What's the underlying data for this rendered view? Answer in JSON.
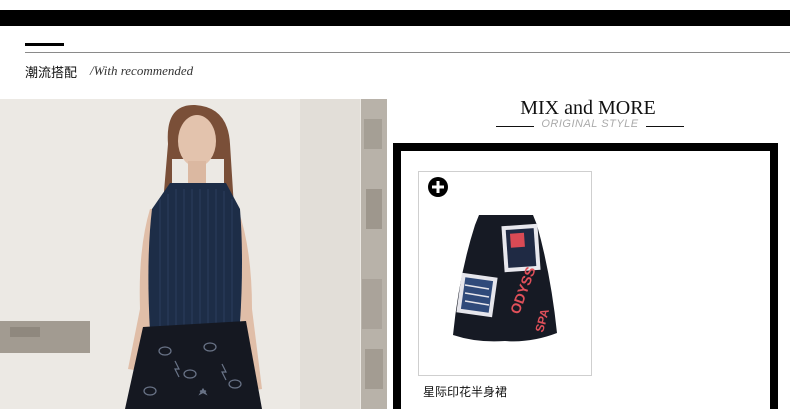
{
  "section": {
    "title_cn": "潮流搭配",
    "title_en": "/With recommended"
  },
  "mix": {
    "title": "MIX and MORE",
    "subtitle": "ORIGINAL STYLE"
  },
  "product": {
    "name": "星际印花半身裙",
    "add_icon": "plus-circle-icon",
    "print_text_1": "ODYSS",
    "print_text_2": "SPA"
  },
  "colors": {
    "top_bar": "#000000",
    "frame": "#000000",
    "subtitle": "#aaaaaa",
    "top_color": "#1d2d47",
    "skirt_base": "#161a24",
    "skirt_print_accent": "#e0505a"
  }
}
